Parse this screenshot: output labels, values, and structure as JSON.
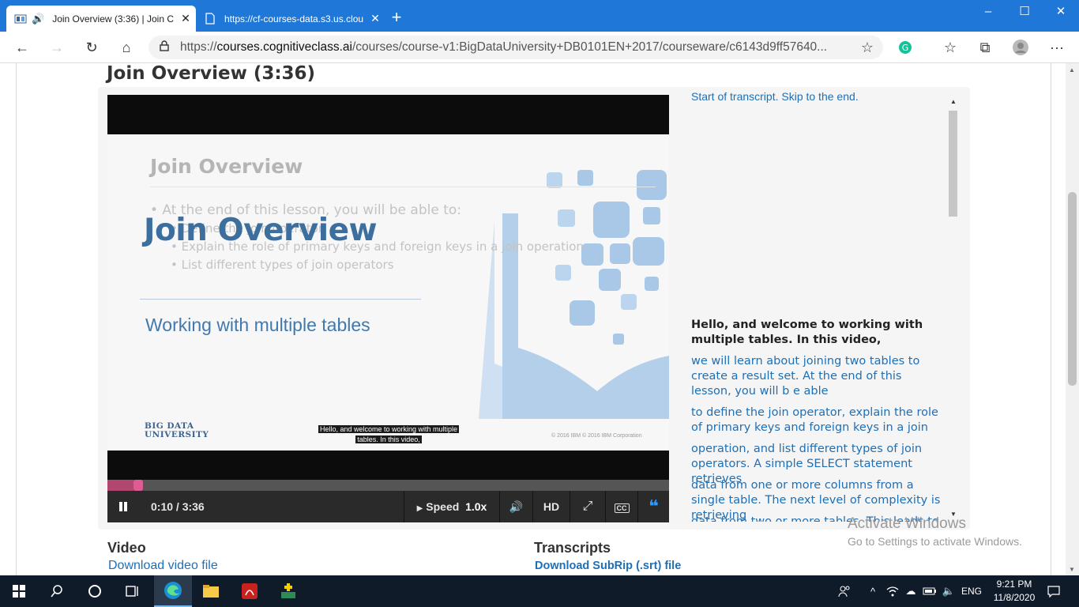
{
  "browser": {
    "tabs": [
      {
        "title": "Join Overview (3:36) | Join C",
        "active": true
      },
      {
        "title": "https://cf-courses-data.s3.us.clou",
        "active": false
      }
    ],
    "url_prefix": "https://",
    "url_host": "courses.cognitiveclass.ai",
    "url_path": "/courses/course-v1:BigDataUniversity+DB0101EN+2017/courseware/c6143d9ff57640..."
  },
  "page": {
    "unit_title": "Join Overview (3:36)"
  },
  "slide": {
    "bg_title": "Join Overview",
    "bullet_1": "• At the end of this lesson, you will be able to:",
    "bullet_2": "• Define the join operator",
    "bullet_3": "• Explain the role of primary keys and foreign keys in a join operation",
    "bullet_4": "• List different types of join operators",
    "main_title": "Join Overview",
    "subtitle": "Working with multiple tables",
    "logo_line1": "BIG DATA",
    "logo_line2": "UNIVERSITY",
    "caption_line1": "Hello, and welcome to working with multiple",
    "caption_line2": "tables. In this video,",
    "copyright": "© 2016 IBM  © 2016 IBM Corporation"
  },
  "player": {
    "progress_fraction": 0.046,
    "time": "0:10 / 3:36",
    "speed_label": "Speed",
    "speed_value": "1.0x",
    "hd_label": "HD",
    "cc_label": "CC"
  },
  "transcript": {
    "skip_link": "Start of transcript. Skip to the end.",
    "lines": [
      {
        "text": "Hello, and welcome to working with multiple tables. In this video,",
        "current": true
      },
      {
        "text": "we will learn about joining two tables to create a result set. At the end of this lesson, you will b e able"
      },
      {
        "text": "to define the join operator, explain the role of primary keys and foreign keys in a join"
      },
      {
        "text": "operation, and list different types of join operators. A simple SELECT statement retrieves"
      },
      {
        "text": "data from one or more columns from a single table. The next level of complexity is retrieving"
      },
      {
        "text": "data from two or more tables. This leads to multiple possibilities of how the result set"
      }
    ]
  },
  "downloads": {
    "video_heading": "Video",
    "video_link": "Download video file",
    "transcripts_heading": "Transcripts",
    "srt_link": "Download SubRip (.srt) file"
  },
  "watermark": {
    "line1": "Activate Windows",
    "line2": "Go to Settings to activate Windows."
  },
  "taskbar": {
    "language": "ENG",
    "time": "9:21 PM",
    "date": "11/8/2020"
  }
}
